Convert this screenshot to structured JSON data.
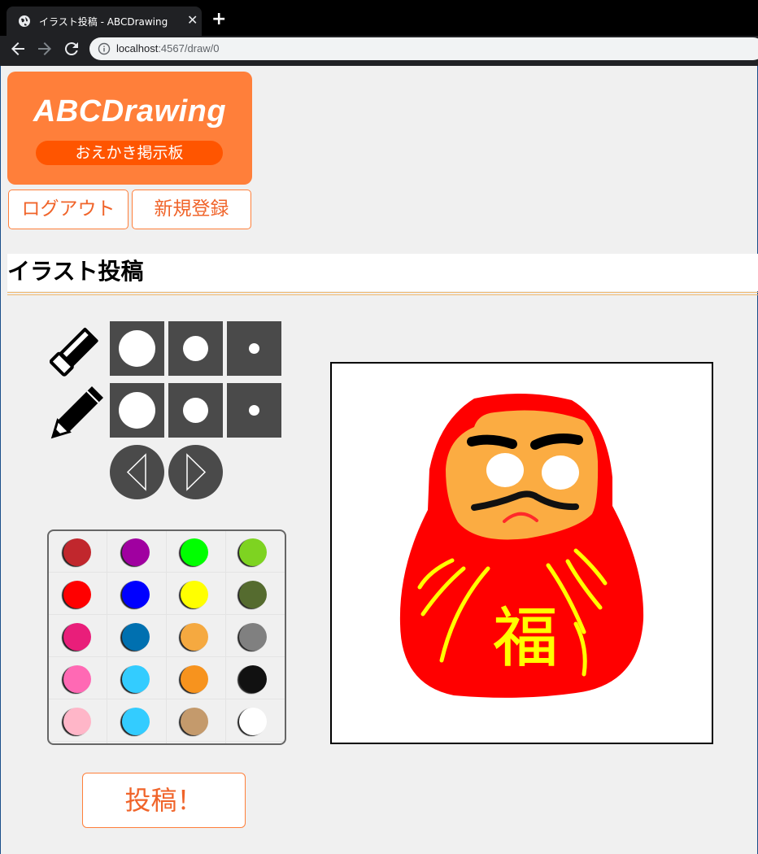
{
  "browser": {
    "tab_title": "イラスト投稿 - ABCDrawing",
    "url_host": "localhost",
    "url_path": ":4567/draw/0"
  },
  "logo": {
    "title": "ABCDrawing",
    "subtitle": "おえかき掲示板"
  },
  "nav": {
    "logout_label": "ログアウト",
    "register_label": "新規登録"
  },
  "page_title": "イラスト投稿",
  "tools": {
    "eraser_icon": "eraser-icon",
    "pencil_icon": "pencil-icon",
    "sizes": [
      "large",
      "medium",
      "small"
    ],
    "undo_icon": "undo-triangle-icon",
    "redo_icon": "redo-triangle-icon"
  },
  "palette": {
    "colors": [
      [
        "#c1272d",
        "#a000a0",
        "#00ff00",
        "#7ed321"
      ],
      [
        "#ff0000",
        "#0000ff",
        "#ffff00",
        "#556b2f"
      ],
      [
        "#e91e7a",
        "#0070b0",
        "#f5a940",
        "#808080"
      ],
      [
        "#ff69b4",
        "#33ccff",
        "#f7931e",
        "#111111"
      ],
      [
        "#ffb6c8",
        "#33ccff",
        "#c49a6c",
        "#ffffff"
      ]
    ]
  },
  "canvas": {
    "character": "福"
  },
  "submit_label": "投稿！"
}
